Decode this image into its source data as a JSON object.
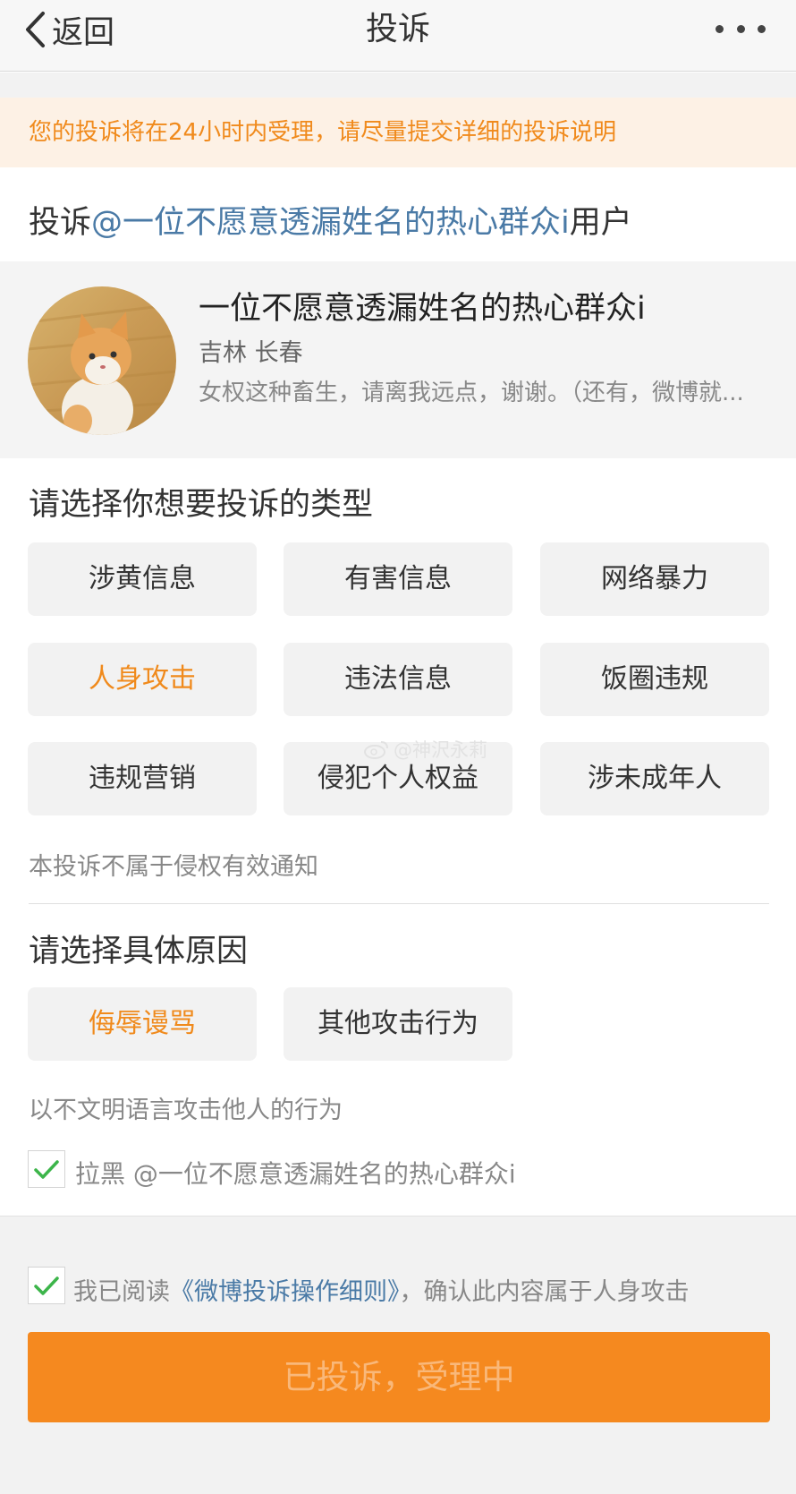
{
  "navbar": {
    "back_label": "返回",
    "title": "投诉"
  },
  "notice": "您的投诉将在24小时内受理，请尽量提交详细的投诉说明",
  "target": {
    "prefix": "投诉",
    "mention": "@一位不愿意透漏姓名的热心群众i",
    "suffix": "用户"
  },
  "user": {
    "name": "一位不愿意透漏姓名的热心群众i",
    "location": "吉林 长春",
    "bio": "女权这种畜生，请离我远点，谢谢。（还有，微博就..."
  },
  "complaint_type": {
    "title": "请选择你想要投诉的类型",
    "options": [
      "涉黄信息",
      "有害信息",
      "网络暴力",
      "人身攻击",
      "违法信息",
      "饭圈违规",
      "违规营销",
      "侵犯个人权益",
      "涉未成年人"
    ],
    "selected": "人身攻击",
    "hint": "本投诉不属于侵权有效通知"
  },
  "reason": {
    "title": "请选择具体原因",
    "options": [
      "侮辱谩骂",
      "其他攻击行为"
    ],
    "selected": "侮辱谩骂",
    "hint": "以不文明语言攻击他人的行为"
  },
  "block": {
    "checked": true,
    "label": "拉黑 @一位不愿意透漏姓名的热心群众i"
  },
  "agreement": {
    "checked": true,
    "prefix": "我已阅读",
    "rules_link": "《微博投诉操作细则》",
    "suffix": "，确认此内容属于人身攻击"
  },
  "submit_label": "已投诉，受理中",
  "watermark": "@神沢永莉",
  "colors": {
    "accent": "#f08a1c",
    "link": "#4a7aa6",
    "button": "#f5891f",
    "check": "#3cb54a"
  }
}
